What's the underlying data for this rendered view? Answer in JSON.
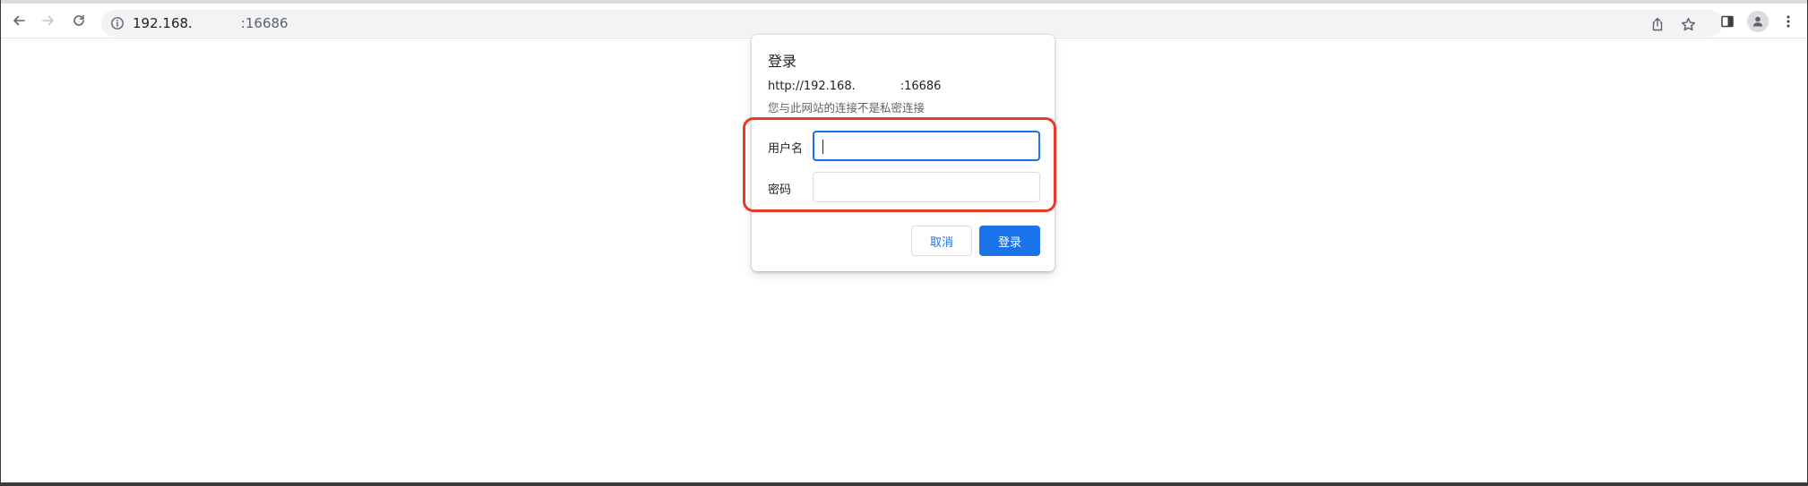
{
  "browser": {
    "url_host": "192.168.",
    "url_port": ":16686",
    "icons": {
      "back": "arrow-left",
      "forward": "arrow-right",
      "reload": "reload",
      "site_info": "info-circle",
      "share": "share",
      "bookmark": "star",
      "side_panel": "side-panel",
      "profile": "person",
      "menu": "kebab"
    }
  },
  "dialog": {
    "title": "登录",
    "origin_host": "http://192.168.",
    "origin_port": ":16686",
    "warning": "您与此网站的连接不是私密连接",
    "username_label": "用户名",
    "username_value": "",
    "password_label": "密码",
    "password_value": "",
    "cancel_label": "取消",
    "submit_label": "登录",
    "highlight_color": "#e53a28",
    "accent_color": "#1a73e8"
  }
}
